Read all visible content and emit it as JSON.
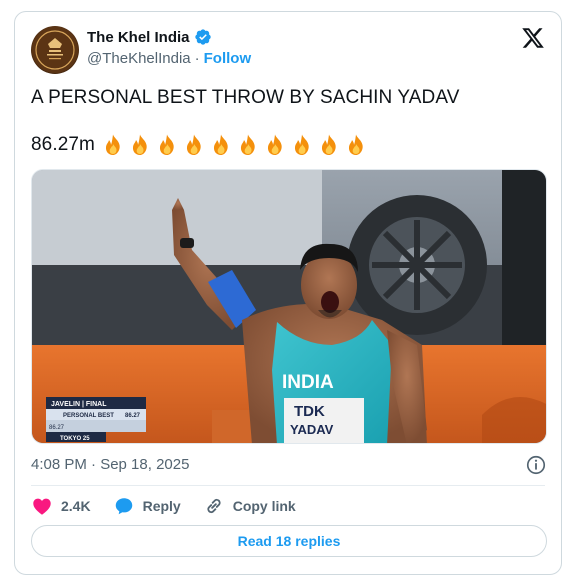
{
  "author": {
    "display_name": "The Khel India",
    "handle": "@TheKhelIndia",
    "separator": "·",
    "follow_label": "Follow",
    "avatar_text": "THE KHEL INDIA"
  },
  "post": {
    "line1": "A PERSONAL BEST THROW BY SACHIN YADAV",
    "line2_text": "86.27m",
    "fire_count": 10
  },
  "media": {
    "jersey_text": "INDIA",
    "bib_sponsor": "TDK",
    "bib_name": "YADAV",
    "graphic": {
      "event": "JAVELIN | FINAL",
      "label": "PERSONAL BEST",
      "value": "86.27",
      "mark": "86.27",
      "footer": "TOKYO 25"
    }
  },
  "meta": {
    "timestamp": "4:08 PM · Sep 18, 2025"
  },
  "actions": {
    "likes": "2.4K",
    "reply_label": "Reply",
    "copy_label": "Copy link"
  },
  "footer": {
    "read_replies": "Read 18 replies"
  },
  "colors": {
    "accent": "#1d9bf0",
    "like": "#f91880",
    "text": "#0f1419",
    "muted": "#536471"
  }
}
